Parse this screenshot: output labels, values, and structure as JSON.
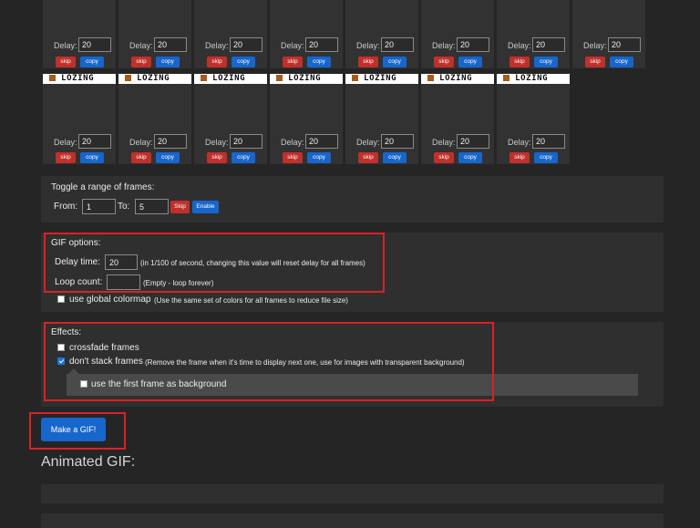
{
  "frames": {
    "delay_label": "Delay:",
    "skip_label": "skip",
    "copy_label": "copy",
    "banner_text": "LOZING",
    "row1_delays": [
      "20",
      "20",
      "20",
      "20",
      "20",
      "20",
      "20",
      "20"
    ],
    "row2_delays": [
      "20",
      "20",
      "20",
      "20",
      "20",
      "20",
      "20"
    ]
  },
  "range": {
    "title": "Toggle a range of frames:",
    "from_label": "From:",
    "from_value": "1",
    "to_label": "To:",
    "to_value": "5",
    "skip_label": "Skip",
    "enable_label": "Enable"
  },
  "gif_options": {
    "title": "GIF options:",
    "delay_label": "Delay time:",
    "delay_value": "20",
    "delay_hint": "(in 1/100 of second, changing this value will reset delay for all frames)",
    "loop_label": "Loop count:",
    "loop_value": "",
    "loop_hint": "(Empty - loop forever)",
    "colormap_label": "use global colormap",
    "colormap_hint": "(Use the same set of colors for all frames to reduce file size)"
  },
  "effects": {
    "title": "Effects:",
    "crossfade_label": "crossfade frames",
    "nostack_label": "don't stack frames",
    "nostack_hint": "(Remove the frame when it's time to display next one, use for images with transparent background)",
    "first_bg_label": "use the first frame as background"
  },
  "actions": {
    "make_gif_label": "Make a GIF!"
  },
  "output": {
    "heading": "Animated GIF:"
  },
  "colors": {
    "skip": "#c0302b",
    "copy": "#1766cc",
    "highlight": "#d92128",
    "checkbox_checked": "#1a73e8"
  }
}
